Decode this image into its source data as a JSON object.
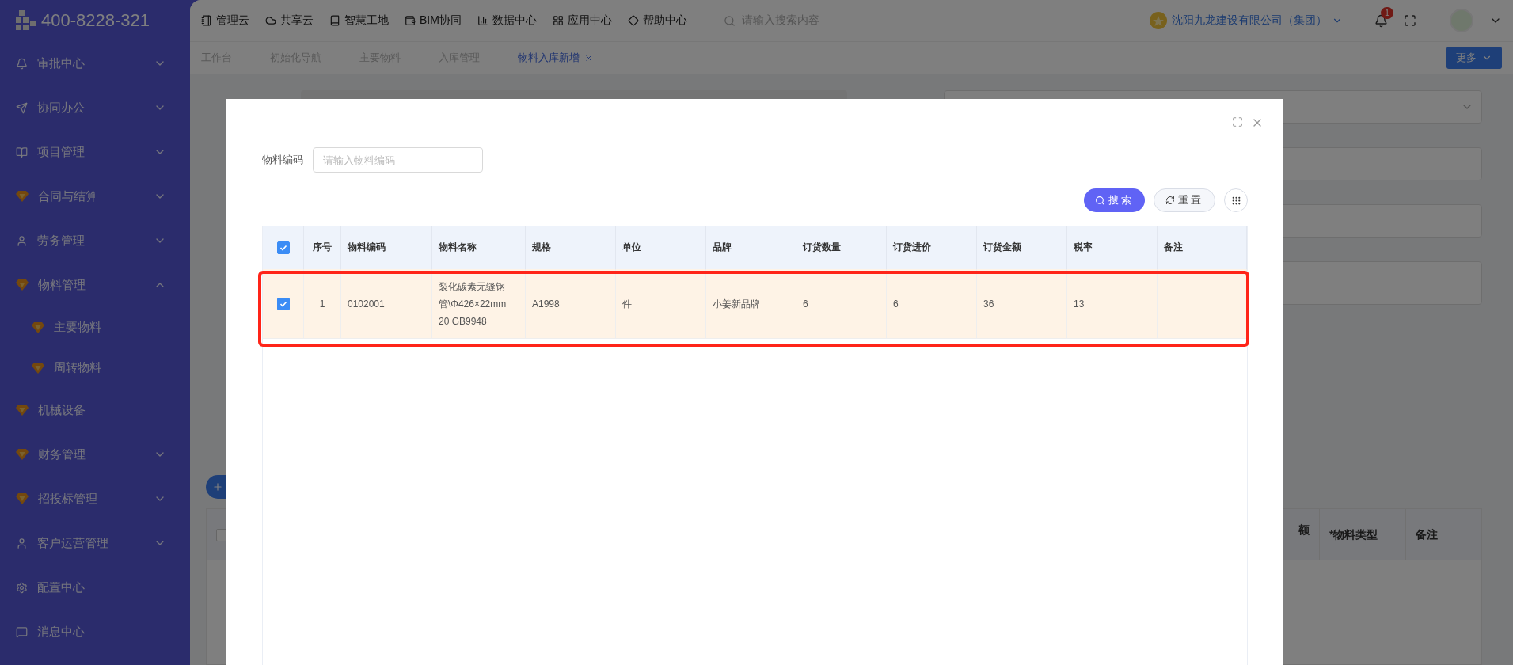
{
  "sidebar": {
    "phone": "400-8228-321",
    "items": [
      {
        "label": "审批中心",
        "kind": "group",
        "expanded": false
      },
      {
        "label": "协同办公",
        "kind": "group",
        "expanded": false
      },
      {
        "label": "项目管理",
        "kind": "group",
        "expanded": false
      },
      {
        "label": "合同与结算",
        "kind": "group",
        "expanded": false
      },
      {
        "label": "劳务管理",
        "kind": "group",
        "expanded": false
      },
      {
        "label": "物料管理",
        "kind": "group",
        "expanded": true,
        "children": [
          {
            "label": "主要物料"
          },
          {
            "label": "周转物料"
          }
        ]
      },
      {
        "label": "机械设备",
        "kind": "link"
      },
      {
        "label": "财务管理",
        "kind": "group",
        "expanded": false
      },
      {
        "label": "招投标管理",
        "kind": "group",
        "expanded": false
      },
      {
        "label": "客户运营管理",
        "kind": "group",
        "expanded": false
      },
      {
        "label": "配置中心",
        "kind": "link"
      },
      {
        "label": "消息中心",
        "kind": "link"
      }
    ]
  },
  "header": {
    "nav": [
      "管理云",
      "共享云",
      "智慧工地",
      "BIM协同",
      "数据中心",
      "应用中心",
      "帮助中心"
    ],
    "search": {
      "placeholder": "请输入搜索内容"
    },
    "company": "沈阳九龙建设有限公司（集团）",
    "notification_count": "1"
  },
  "tabs": [
    {
      "label": "工作台",
      "selected": false
    },
    {
      "label": "初始化导航",
      "selected": false
    },
    {
      "label": "主要物料",
      "selected": false
    },
    {
      "label": "入库管理",
      "selected": false
    },
    {
      "label": "物料入库新增",
      "selected": true
    }
  ],
  "more_button": "更多",
  "background_table": {
    "checked": false,
    "columns": [
      "额",
      "*物料类型",
      "备注"
    ]
  },
  "dialog": {
    "filter": {
      "label": "物料编码",
      "placeholder": "请输入物料编码"
    },
    "search_button": "搜索",
    "reset_button": "重置",
    "table": {
      "all_checked": true,
      "columns": [
        "序号",
        "物料编码",
        "物料名称",
        "规格",
        "单位",
        "品牌",
        "订货数量",
        "订货进价",
        "订货金额",
        "税率",
        "备注"
      ],
      "rows": [
        {
          "checked": true,
          "highlighted": true,
          "cells": [
            "1",
            "0102001",
            "裂化碳素无缝钢管\\Φ426×22mm 20 GB9948",
            "A1998",
            "件",
            "小姜新品牌",
            "6",
            "6",
            "36",
            "13",
            ""
          ]
        }
      ]
    }
  }
}
